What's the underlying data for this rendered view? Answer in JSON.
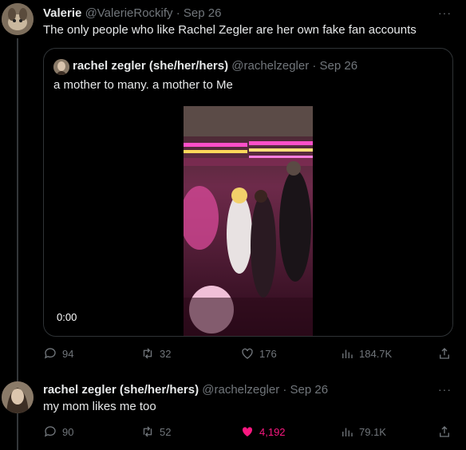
{
  "tweet1": {
    "name": "Valerie",
    "handle": "@ValerieRockify",
    "separator": "·",
    "date": "Sep 26",
    "text": "The only people who like Rachel Zegler are her own fake fan accounts",
    "more": "···",
    "quote": {
      "name": "rachel zegler (she/her/hers)",
      "handle": "@rachelzegler",
      "separator": "·",
      "date": "Sep 26",
      "text": "a mother to many. a mother to Me",
      "video_time": "0:00"
    },
    "stats": {
      "replies": "94",
      "retweets": "32",
      "likes": "176",
      "views": "184.7K"
    }
  },
  "tweet2": {
    "name": "rachel zegler (she/her/hers)",
    "handle": "@rachelzegler",
    "separator": "·",
    "date": "Sep 26",
    "text": "my mom likes me too",
    "more": "···",
    "stats": {
      "replies": "90",
      "retweets": "52",
      "likes": "4,192",
      "views": "79.1K"
    },
    "liked": true
  },
  "colors": {
    "like_active": "#f91880",
    "muted": "#71767b",
    "border": "#2f3336"
  },
  "icons": [
    "reply-icon",
    "retweet-icon",
    "like-icon",
    "views-icon",
    "share-icon",
    "more-icon"
  ]
}
